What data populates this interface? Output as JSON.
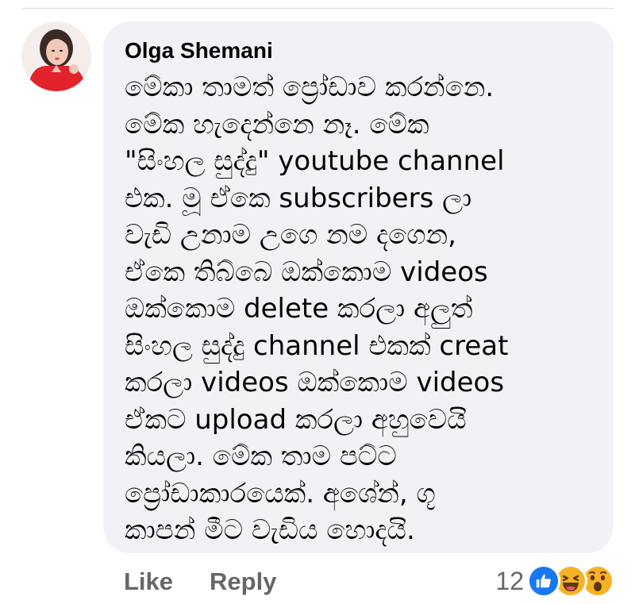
{
  "comment": {
    "author": "Olga Shemani",
    "lines": [
      "මේකා තාමත් ප්‍රෝඩාව කරන්නෙ.",
      "මේක හැදෙන්නෙ නෑ. මේක",
      "\"සිංහල සුද්දු\" youtube channel",
      "එක. මූ ඒකෙ subscribers ලා",
      "වැඩි උනාම උගෙ නම දගෙන,",
      "ඒකෙ තිබ්බෙ ඔක්කොම videos",
      "ඔක්කොම delete කරලා අලුත්",
      "සිංහල සුද්දු channel එකක් creat",
      "කරලා videos ඔක්කොම videos",
      "ඒකට upload කරලා අහුවෙයි",
      "කියලා. මේක තාම පට්ට",
      "ප්‍රෝඩාකාරයෙක්. අශේන්, ගූ",
      "කාපන් මීට වැඩිය හොදයි."
    ]
  },
  "actions": {
    "like_label": "Like",
    "reply_label": "Reply"
  },
  "reactions": {
    "count": "12",
    "types": [
      "like-icon",
      "haha-icon",
      "wow-icon"
    ]
  },
  "colors": {
    "bubble": "#f0f2f5",
    "text": "#050505",
    "secondary_text": "#65676b",
    "like_blue": "#1877f2",
    "emoji_yellow": "#f7b125"
  }
}
